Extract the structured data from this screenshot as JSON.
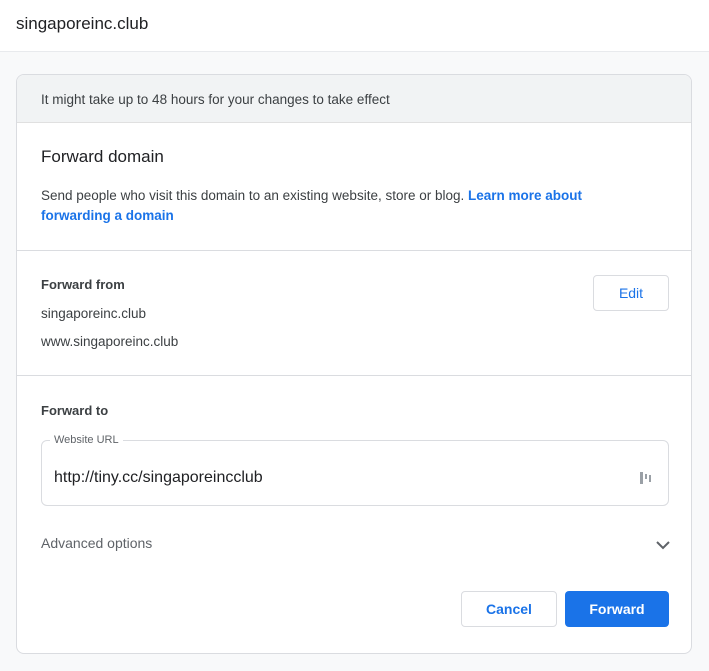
{
  "header": {
    "domain": "singaporeinc.club"
  },
  "notice": {
    "text": "It might take up to 48 hours for your changes to take effect"
  },
  "forward_domain": {
    "title": "Forward domain",
    "description": "Send people who visit this domain to an existing website, store or blog. ",
    "learn_more_link": "Learn more about forwarding a domain"
  },
  "forward_from": {
    "label": "Forward from",
    "domains": [
      "singaporeinc.club",
      "www.singaporeinc.club"
    ],
    "edit_label": "Edit"
  },
  "forward_to": {
    "label": "Forward to",
    "url_field_label": "Website URL",
    "url_value": "http://tiny.cc/singaporeincclub",
    "advanced_label": "Advanced options",
    "cancel_label": "Cancel",
    "forward_label": "Forward"
  },
  "colors": {
    "accent": "#1a73e8",
    "notice_bg": "#f1f3f4",
    "border": "#dadce0"
  },
  "icons": {
    "url_field": "bookmark-slots-icon",
    "advanced": "chevron-down-icon"
  }
}
